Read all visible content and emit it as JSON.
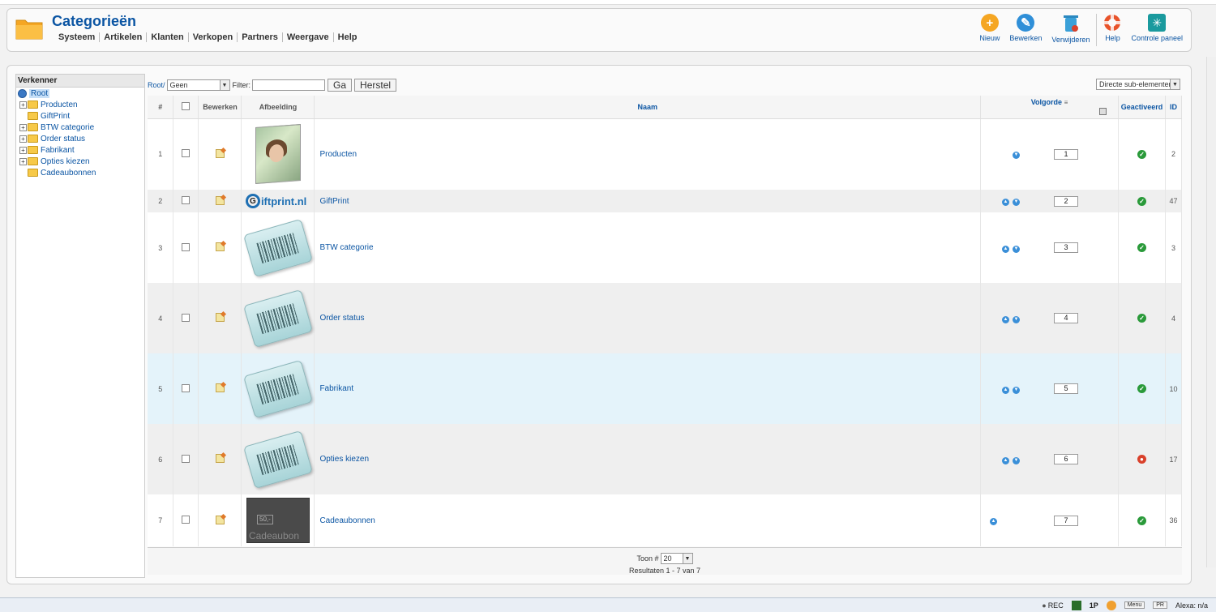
{
  "header": {
    "title": "Categorieën",
    "menu": [
      "Systeem",
      "Artikelen",
      "Klanten",
      "Verkopen",
      "Partners",
      "Weergave",
      "Help"
    ],
    "toolbar": {
      "new": "Nieuw",
      "edit": "Bewerken",
      "delete": "Verwijderen",
      "help": "Help",
      "control": "Controle paneel"
    }
  },
  "explorer": {
    "title": "Verkenner",
    "root": "Root",
    "items": [
      {
        "label": "Producten",
        "expandable": true
      },
      {
        "label": "GiftPrint",
        "expandable": false
      },
      {
        "label": "BTW categorie",
        "expandable": true
      },
      {
        "label": "Order status",
        "expandable": true
      },
      {
        "label": "Fabrikant",
        "expandable": true
      },
      {
        "label": "Opties kiezen",
        "expandable": true
      },
      {
        "label": "Cadeaubonnen",
        "expandable": false
      }
    ]
  },
  "filter": {
    "root_link": "Root/",
    "select_value": "Geen",
    "filter_label": "Filter:",
    "filter_value": "",
    "go_button": "Ga",
    "reset_button": "Herstel",
    "view_select": "Directe sub-elementen"
  },
  "columns": {
    "num": "#",
    "edit": "Bewerken",
    "image": "Afbeelding",
    "name": "Naam",
    "order": "Volgorde",
    "active": "Geactiveerd",
    "id": "ID"
  },
  "rows": [
    {
      "num": "1",
      "name": "Producten",
      "order": "1",
      "id": "2",
      "active": true,
      "image": "photo",
      "arrows": [
        "down"
      ]
    },
    {
      "num": "2",
      "name": "GiftPrint",
      "order": "2",
      "id": "47",
      "active": true,
      "image": "logo",
      "arrows": [
        "up",
        "down"
      ]
    },
    {
      "num": "3",
      "name": "BTW categorie",
      "order": "3",
      "id": "3",
      "active": true,
      "image": "barcode",
      "arrows": [
        "up",
        "down"
      ]
    },
    {
      "num": "4",
      "name": "Order status",
      "order": "4",
      "id": "4",
      "active": true,
      "image": "barcode",
      "arrows": [
        "up",
        "down"
      ]
    },
    {
      "num": "5",
      "name": "Fabrikant",
      "order": "5",
      "id": "10",
      "active": true,
      "image": "barcode",
      "arrows": [
        "up",
        "down"
      ]
    },
    {
      "num": "6",
      "name": "Opties kiezen",
      "order": "6",
      "id": "17",
      "active": false,
      "image": "barcode",
      "arrows": [
        "up",
        "down"
      ]
    },
    {
      "num": "7",
      "name": "Cadeaubonnen",
      "order": "7",
      "id": "36",
      "active": true,
      "image": "cadeau",
      "arrows": [
        "up"
      ]
    }
  ],
  "images": {
    "logo_text": "iftprint.nl",
    "logo_g": "G",
    "cadeau_value": "50,-",
    "cadeau_text": "Cadeaubon"
  },
  "footer": {
    "show_label": "Toon #",
    "show_value": "20",
    "results": "Resultaten 1 - 7 van 7"
  },
  "statusbar": {
    "rec": "REC",
    "onep": "1P",
    "menu": "Menu",
    "pr": "PR",
    "alexa": "Alexa: n/a"
  },
  "colors": {
    "accent": "#0b55a3",
    "active": "#2a9a3a",
    "inactive": "#d9412b",
    "highlight_row": "#e4f3fa"
  }
}
